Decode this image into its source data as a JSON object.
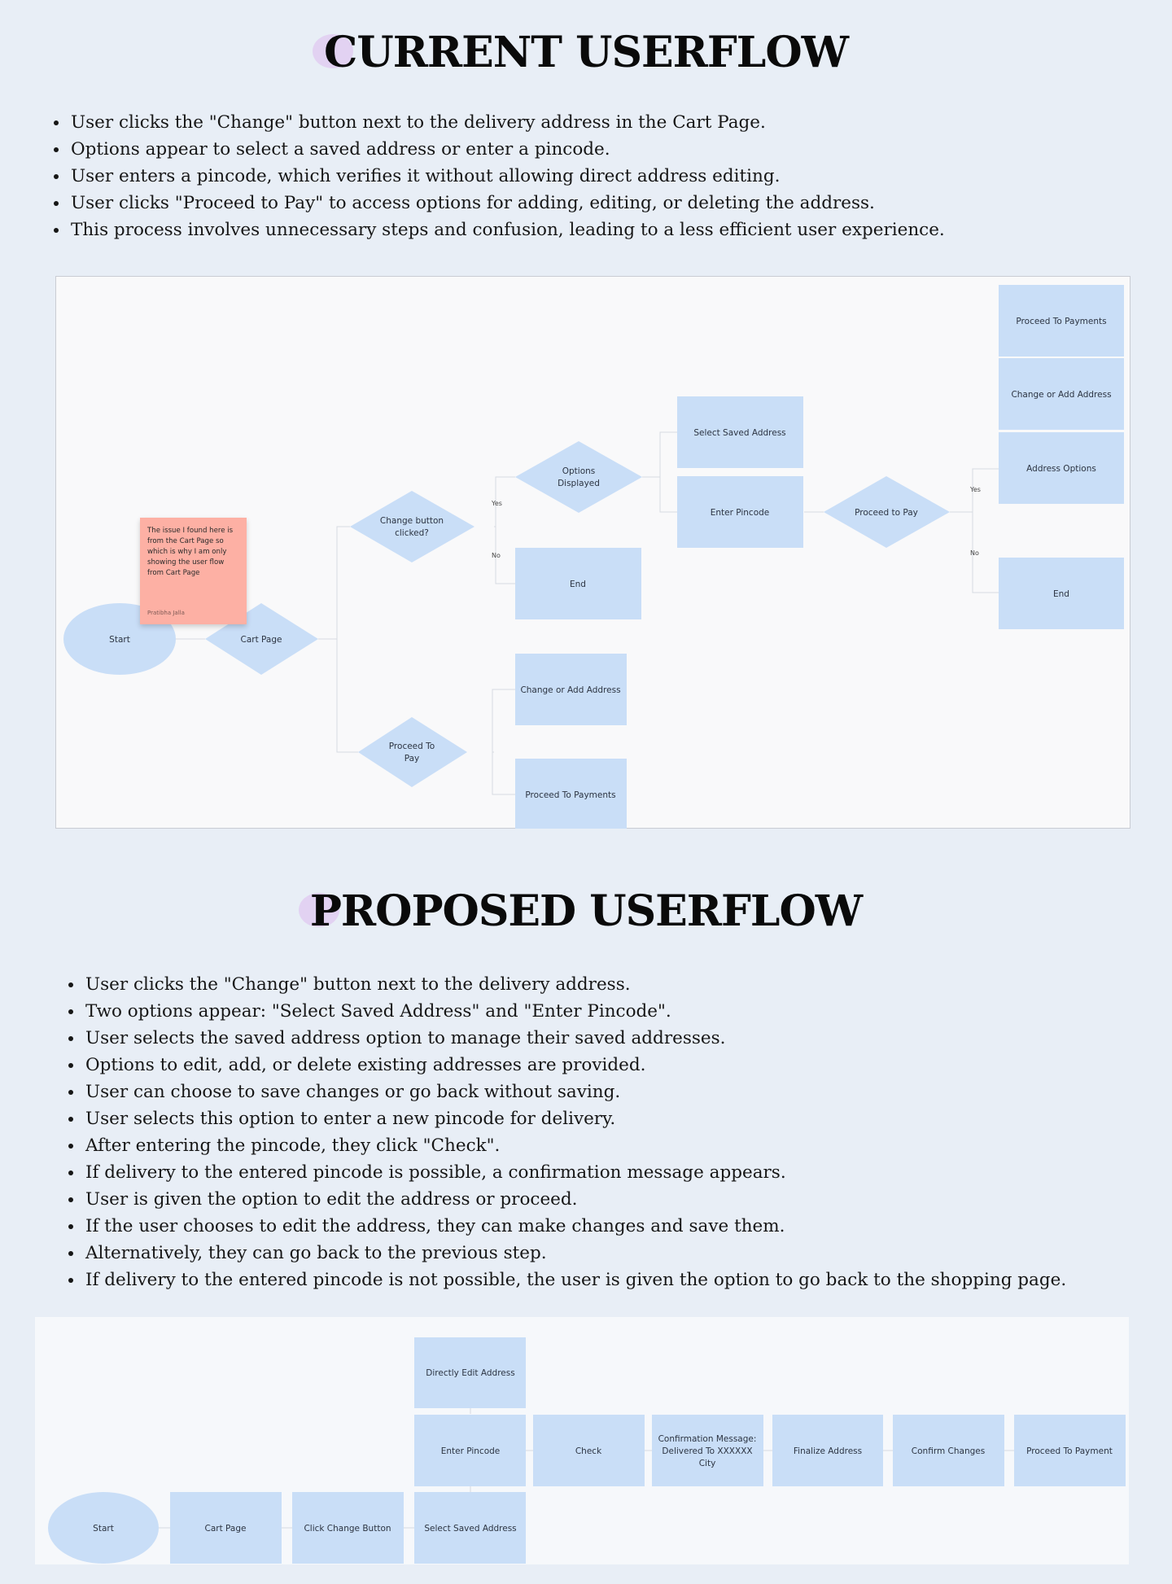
{
  "current": {
    "title": "CURRENT USERFLOW",
    "bullets": [
      "User clicks the \"Change\" button next to the delivery address in the Cart Page.",
      "Options appear to select a saved address or enter a pincode.",
      "User enters a pincode, which verifies it without allowing direct address editing.",
      "User clicks \"Proceed to Pay\" to access options for adding, editing, or deleting the address.",
      "This process involves unnecessary steps and confusion, leading to a less efficient user experience."
    ],
    "diagram": {
      "start": "Start",
      "cart_page": "Cart Page",
      "change_clicked_1": "Change button",
      "change_clicked_2": "clicked?",
      "options_displayed_1": "Options",
      "options_displayed_2": "Displayed",
      "end_1": "End",
      "select_saved_address": "Select Saved Address",
      "enter_pincode": "Enter Pincode",
      "proceed_to_pay_right": "Proceed to Pay",
      "proceed_to_payments_top": "Proceed To Payments",
      "change_or_add_top": "Change or Add Address",
      "address_options": "Address Options",
      "end_2": "End",
      "proceed_to_pay_bottom_1": "Proceed To",
      "proceed_to_pay_bottom_2": "Pay",
      "change_or_add_bottom": "Change or Add Address",
      "proceed_to_payments_bottom": "Proceed To Payments",
      "yes_1": "Yes",
      "no_1": "No",
      "yes_2": "Yes",
      "no_2": "No"
    },
    "sticky_note": {
      "text": "The issue I found here is from the Cart Page so which is why I am only showing the user flow from Cart Page",
      "author": "Pratibha Jalla"
    }
  },
  "proposed": {
    "title": "PROPOSED USERFLOW",
    "bullets": [
      "User clicks the \"Change\" button next to the delivery address.",
      "Two options appear: \"Select Saved Address\" and \"Enter Pincode\".",
      "User selects the saved address option to manage their saved addresses.",
      "Options to edit, add, or delete existing addresses are provided.",
      "User can choose to save changes or go back without saving.",
      "User selects this option to enter a new pincode for delivery.",
      "After entering the pincode, they click \"Check\".",
      "If delivery to the entered pincode is possible, a confirmation message appears.",
      "User is given the option to edit the address or proceed.",
      "If the user chooses to edit the address, they can make changes and save them.",
      "Alternatively, they can go back to the previous step.",
      "If delivery to the entered pincode is not possible, the user is given the option to go back to the shopping page."
    ],
    "diagram": {
      "start": "Start",
      "cart_page": "Cart Page",
      "click_change_button": "Click Change Button",
      "select_saved_address": "Select Saved Address",
      "enter_pincode": "Enter Pincode",
      "directly_edit_address": "Directly Edit Address",
      "check": "Check",
      "confirmation_1": "Confirmation Message:",
      "confirmation_2": "Delivered To XXXXXX",
      "confirmation_3": "City",
      "finalize_address": "Finalize Address",
      "confirm_changes": "Confirm Changes",
      "proceed_to_payment": "Proceed To Payment"
    }
  }
}
